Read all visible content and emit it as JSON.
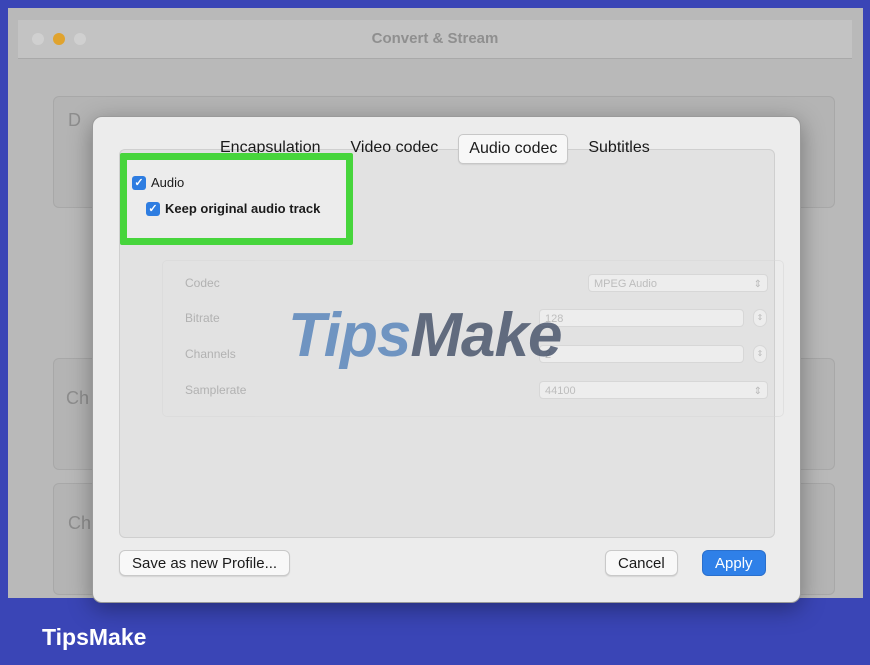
{
  "window": {
    "title": "Convert & Stream",
    "bg_label_1": "D",
    "bg_label_2": "Ch",
    "bg_label_3": "Ch"
  },
  "tabs": [
    {
      "label": "Encapsulation",
      "active": false
    },
    {
      "label": "Video codec",
      "active": false
    },
    {
      "label": "Audio codec",
      "active": true
    },
    {
      "label": "Subtitles",
      "active": false
    }
  ],
  "audio_checkbox": {
    "label": "Audio",
    "checked": true
  },
  "keep_original_checkbox": {
    "label": "Keep original audio track",
    "checked": true
  },
  "params": {
    "codec_label": "Codec",
    "codec_value": "MPEG Audio",
    "bitrate_label": "Bitrate",
    "bitrate_value": "128",
    "channels_label": "Channels",
    "channels_value": "2",
    "samplerate_label": "Samplerate",
    "samplerate_value": "44100"
  },
  "buttons": {
    "save_profile": "Save as new Profile...",
    "cancel": "Cancel",
    "apply": "Apply"
  },
  "watermark": {
    "part1": "Tips",
    "part2": "Make"
  },
  "footer": {
    "brand": "TipsMake"
  },
  "colors": {
    "accent": "#2f80e8",
    "highlight": "#47d53c",
    "footer_bg": "#3a45b6"
  }
}
